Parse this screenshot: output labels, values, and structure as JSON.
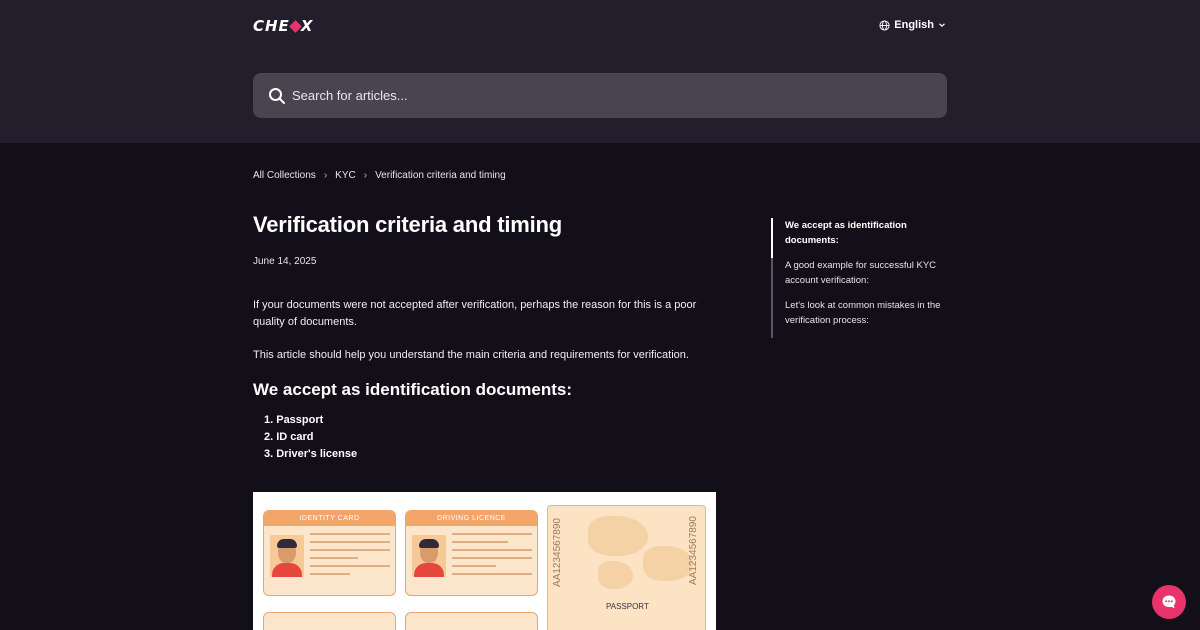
{
  "header": {
    "logo_text": "CHEXX",
    "language": "English",
    "search_placeholder": "Search for articles..."
  },
  "breadcrumb": {
    "items": [
      "All Collections",
      "KYC",
      "Verification criteria and timing"
    ]
  },
  "article": {
    "title": "Verification criteria and timing",
    "date": "June 14, 2025",
    "paragraph1": "If your documents were not accepted after verification, perhaps the reason for this is a poor quality of documents.",
    "paragraph2": "This article should help you understand the main criteria and requirements for verification.",
    "section_heading": "We accept as identification documents:",
    "documents": [
      "1. Passport",
      "2. ID card",
      "3. Driver's license"
    ],
    "image_labels": {
      "identity_card": "IDENTITY CARD",
      "driving_licence": "DRIVING LICENCE",
      "passport": "PASSPORT",
      "passport_number": "AA1234567890"
    }
  },
  "toc": {
    "items": [
      "We accept as identification documents:",
      "A good example for successful KYC account verification:",
      "Let's look at common mistakes in the verification process:"
    ]
  },
  "colors": {
    "header_bg": "#231e2b",
    "page_bg": "#130f18",
    "accent": "#e8336b"
  }
}
